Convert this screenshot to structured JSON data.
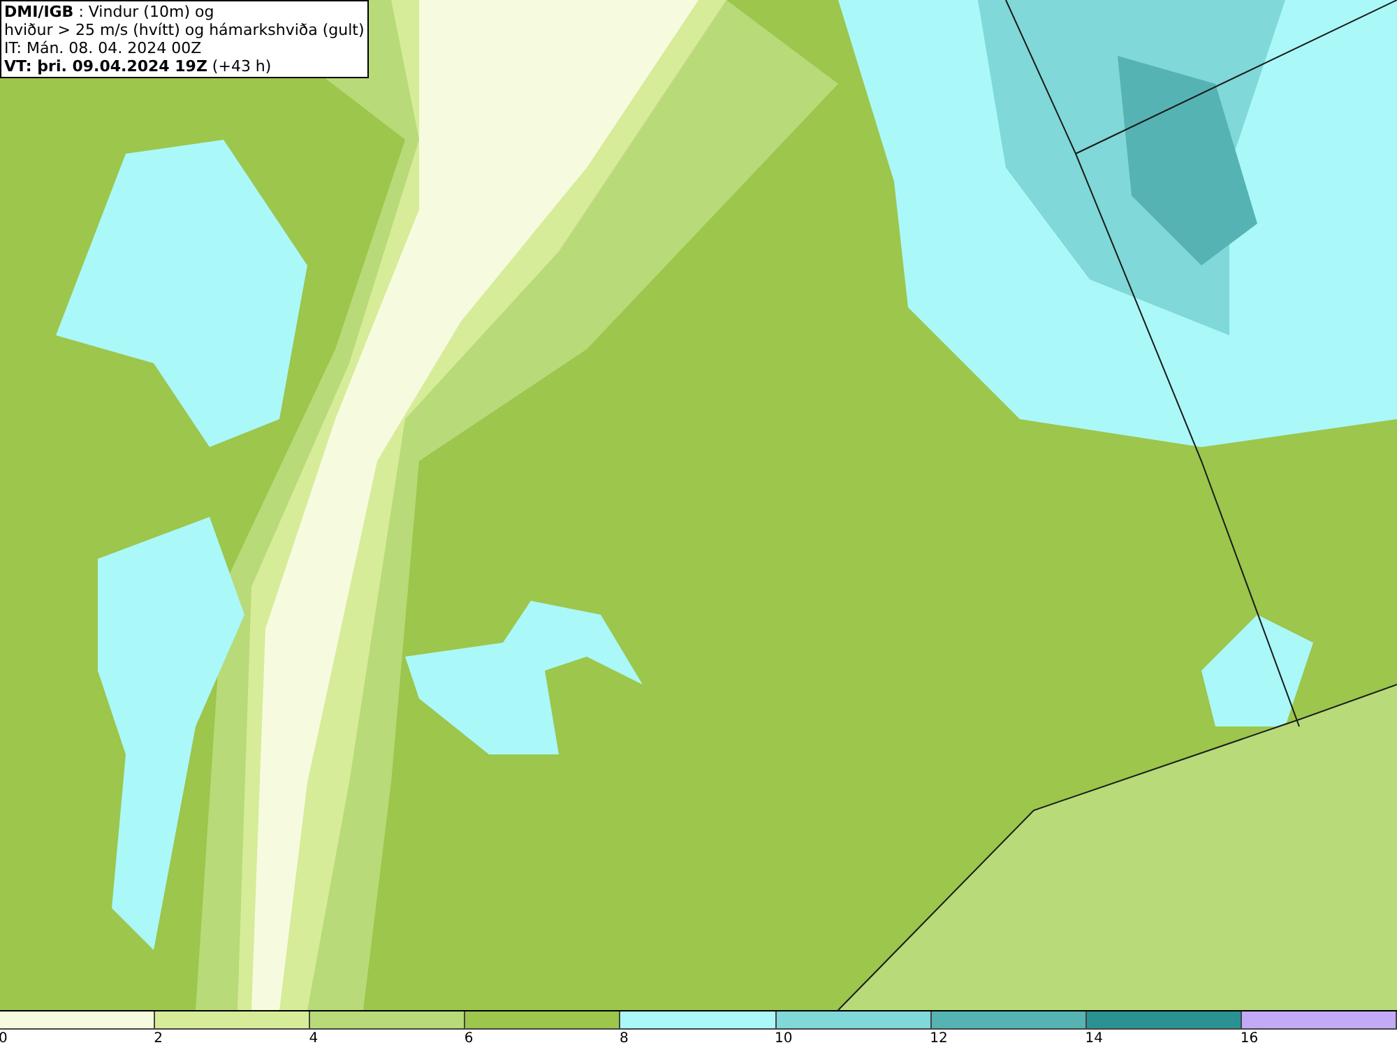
{
  "header": {
    "lines": [
      "**DMI/IGB** : Vindur (10m) og",
      "hviður > 25 m/s (hvítt) og hámarkshviða (gult)",
      "IT: Mán. 08. 04. 2024 00Z",
      "**VT: þri. 09.04.2024 19Z** (+43 h)"
    ]
  },
  "legend": [
    {
      "label": "0",
      "color": "#f6fbdf"
    },
    {
      "label": "2",
      "color": "#d6ec99"
    },
    {
      "label": "4",
      "color": "#b8da78"
    },
    {
      "label": "6",
      "color": "#9cc64c"
    },
    {
      "label": "8",
      "color": "#aaf8f8"
    },
    {
      "label": "10",
      "color": "#80d8d8"
    },
    {
      "label": "12",
      "color": "#56b3b3"
    },
    {
      "label": "14",
      "color": "#2a9292"
    },
    {
      "label": "16",
      "color": "#c2aaf7"
    }
  ]
}
